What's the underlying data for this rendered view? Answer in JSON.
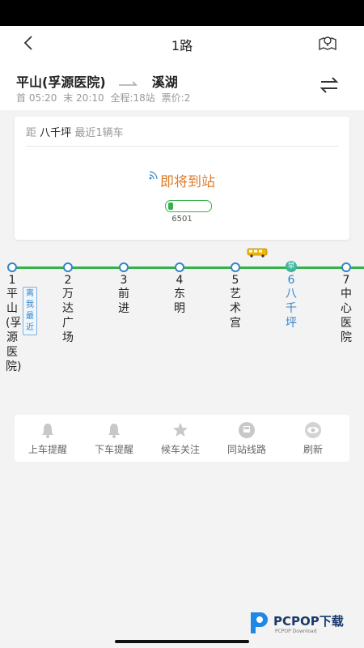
{
  "header": {
    "title": "1路",
    "origin": "平山(孚源医院)",
    "destination": "溪湖",
    "meta": {
      "first": "首 05:20",
      "last": "末 20:10",
      "stops": "全程:18站",
      "fare": "票价:2"
    }
  },
  "card": {
    "distance_prefix": "距",
    "target_stop": "八千坪",
    "nearest": "最近1辆车",
    "status": "即将到站",
    "bus_plate": "6501",
    "colors": {
      "status": "#e07b2a",
      "bus": "#35b24a"
    }
  },
  "line": {
    "stops": [
      {
        "num": "1",
        "name": "平山(孚源医院)",
        "current": false
      },
      {
        "num": "2",
        "name": "万达广场",
        "current": false
      },
      {
        "num": "3",
        "name": "前进",
        "current": false
      },
      {
        "num": "4",
        "name": "东明",
        "current": false
      },
      {
        "num": "5",
        "name": "艺术宫",
        "current": false
      },
      {
        "num": "6",
        "name": "八千坪",
        "current": true
      },
      {
        "num": "7",
        "name": "中心医院",
        "current": false
      }
    ],
    "nearest_tag": "离我最近",
    "current_badge": "早",
    "colors": {
      "track": "#35b24a",
      "current": "#3585c8"
    }
  },
  "toolbar": {
    "items": [
      {
        "label": "上车提醒",
        "icon": "bell-icon"
      },
      {
        "label": "下车提醒",
        "icon": "bell-icon"
      },
      {
        "label": "候车关注",
        "icon": "star-icon"
      },
      {
        "label": "同站线路",
        "icon": "station-icon"
      },
      {
        "label": "刷新",
        "icon": "eye-refresh-icon"
      }
    ]
  },
  "watermark": {
    "brand": "PCPOP下载",
    "sub": "PCPOP Download"
  }
}
